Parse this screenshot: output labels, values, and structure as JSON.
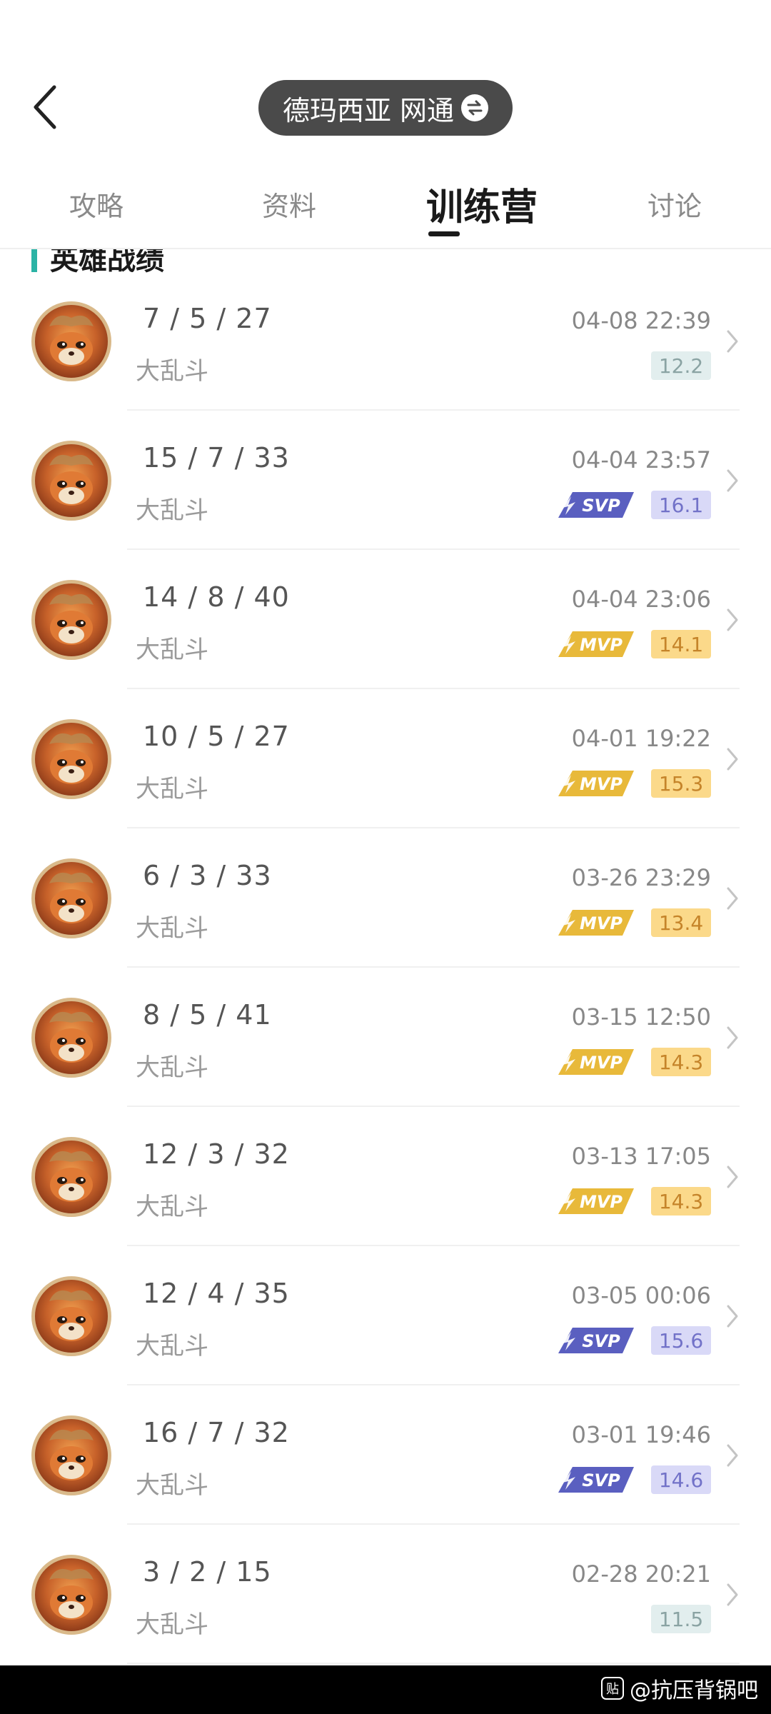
{
  "header": {
    "server_label": "德玛西亚 网通",
    "back_icon": "chevron-left-icon",
    "swap_icon": "swap-icon"
  },
  "tabs": [
    {
      "label": "攻略"
    },
    {
      "label": "资料"
    },
    {
      "label": "训练营"
    },
    {
      "label": "讨论"
    }
  ],
  "active_tab": "训练营",
  "section": {
    "title": "英雄战绩",
    "accent_color": "#2bb3a5"
  },
  "badges": {
    "svp": "SVP",
    "mvp": "MVP"
  },
  "matches": [
    {
      "kda": "7 / 5 / 27",
      "mode": "大乱斗",
      "time": "04-08 22:39",
      "score": "12.2",
      "badge": "none"
    },
    {
      "kda": "15 / 7 / 33",
      "mode": "大乱斗",
      "time": "04-04 23:57",
      "score": "16.1",
      "badge": "svp"
    },
    {
      "kda": "14 / 8 / 40",
      "mode": "大乱斗",
      "time": "04-04 23:06",
      "score": "14.1",
      "badge": "mvp"
    },
    {
      "kda": "10 / 5 / 27",
      "mode": "大乱斗",
      "time": "04-01 19:22",
      "score": "15.3",
      "badge": "mvp"
    },
    {
      "kda": "6 / 3 / 33",
      "mode": "大乱斗",
      "time": "03-26 23:29",
      "score": "13.4",
      "badge": "mvp"
    },
    {
      "kda": "8 / 5 / 41",
      "mode": "大乱斗",
      "time": "03-15 12:50",
      "score": "14.3",
      "badge": "mvp"
    },
    {
      "kda": "12 / 3 / 32",
      "mode": "大乱斗",
      "time": "03-13 17:05",
      "score": "14.3",
      "badge": "mvp"
    },
    {
      "kda": "12 / 4 / 35",
      "mode": "大乱斗",
      "time": "03-05 00:06",
      "score": "15.6",
      "badge": "svp"
    },
    {
      "kda": "16 / 7 / 32",
      "mode": "大乱斗",
      "time": "03-01 19:46",
      "score": "14.6",
      "badge": "svp"
    },
    {
      "kda": "3 / 2 / 15",
      "mode": "大乱斗",
      "time": "02-28 20:21",
      "score": "11.5",
      "badge": "none"
    }
  ],
  "colors": {
    "svp": "#5a5fc0",
    "mvp": "#e8b93a",
    "score_plain_bg": "#e2eeee"
  },
  "watermark": {
    "icon_label": "贴",
    "text": "@抗压背锅吧"
  }
}
